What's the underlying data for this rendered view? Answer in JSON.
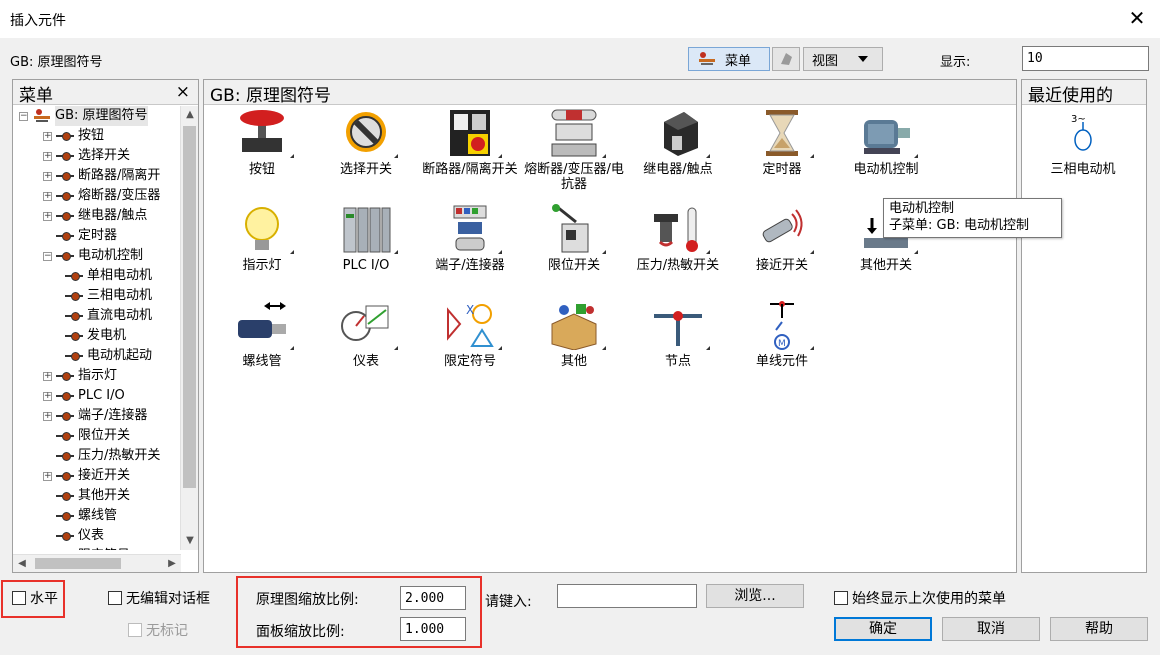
{
  "window": {
    "title": "插入元件",
    "close_glyph": "✕"
  },
  "toolbar": {
    "breadcrumb": "GB: 原理图符号",
    "menu_label": "菜单",
    "view_label": "视图",
    "display_label": "显示:",
    "display_value": "10"
  },
  "left_panel": {
    "title": "菜单",
    "close_glyph": "×",
    "root": "GB: 原理图符号",
    "items": [
      {
        "label": "按钮",
        "expandable": true,
        "indent": 1
      },
      {
        "label": "选择开关",
        "expandable": true,
        "indent": 1
      },
      {
        "label": "断路器/隔离开",
        "expandable": true,
        "indent": 1
      },
      {
        "label": "熔断器/变压器",
        "expandable": true,
        "indent": 1
      },
      {
        "label": "继电器/触点",
        "expandable": true,
        "indent": 1
      },
      {
        "label": "定时器",
        "expandable": false,
        "indent": 1
      },
      {
        "label": "电动机控制",
        "expandable": true,
        "expanded": true,
        "indent": 1
      },
      {
        "label": "单相电动机",
        "expandable": false,
        "indent": 2
      },
      {
        "label": "三相电动机",
        "expandable": false,
        "indent": 2
      },
      {
        "label": "直流电动机",
        "expandable": false,
        "indent": 2
      },
      {
        "label": "发电机",
        "expandable": false,
        "indent": 2
      },
      {
        "label": "电动机起动",
        "expandable": false,
        "indent": 2
      },
      {
        "label": "指示灯",
        "expandable": true,
        "indent": 1
      },
      {
        "label": "PLC I/O",
        "expandable": true,
        "indent": 1
      },
      {
        "label": "端子/连接器",
        "expandable": true,
        "indent": 1
      },
      {
        "label": "限位开关",
        "expandable": false,
        "indent": 1
      },
      {
        "label": "压力/热敏开关",
        "expandable": false,
        "indent": 1
      },
      {
        "label": "接近开关",
        "expandable": true,
        "indent": 1
      },
      {
        "label": "其他开关",
        "expandable": false,
        "indent": 1
      },
      {
        "label": "螺线管",
        "expandable": false,
        "indent": 1
      },
      {
        "label": "仪表",
        "expandable": false,
        "indent": 1
      },
      {
        "label": "限定符号",
        "expandable": true,
        "indent": 1
      }
    ]
  },
  "center_panel": {
    "title": "GB: 原理图符号",
    "items": [
      {
        "label": "按钮",
        "icon": "push-button-icon"
      },
      {
        "label": "选择开关",
        "icon": "selector-switch-icon"
      },
      {
        "label": "断路器/隔离开关",
        "icon": "circuit-breaker-icon"
      },
      {
        "label": "熔断器/变压器/电抗器",
        "icon": "fuse-transformer-icon"
      },
      {
        "label": "继电器/触点",
        "icon": "relay-icon"
      },
      {
        "label": "定时器",
        "icon": "hourglass-icon"
      },
      {
        "label": "电动机控制",
        "icon": "motor-icon"
      },
      {
        "label": "指示灯",
        "icon": "lightbulb-icon"
      },
      {
        "label": "PLC I/O",
        "icon": "plc-icon"
      },
      {
        "label": "端子/连接器",
        "icon": "terminal-icon"
      },
      {
        "label": "限位开关",
        "icon": "limit-switch-icon"
      },
      {
        "label": "压力/热敏开关",
        "icon": "pressure-switch-icon"
      },
      {
        "label": "接近开关",
        "icon": "proximity-switch-icon"
      },
      {
        "label": "其他开关",
        "icon": "other-switch-icon"
      },
      {
        "label": "螺线管",
        "icon": "solenoid-icon"
      },
      {
        "label": "仪表",
        "icon": "meter-icon"
      },
      {
        "label": "限定符号",
        "icon": "qualifier-icon"
      },
      {
        "label": "其他",
        "icon": "misc-box-icon"
      },
      {
        "label": "节点",
        "icon": "node-icon"
      },
      {
        "label": "单线元件",
        "icon": "one-line-icon"
      }
    ]
  },
  "tooltip": {
    "line1": "电动机控制",
    "line2": "子菜单: GB: 电动机控制"
  },
  "right_panel": {
    "title": "最近使用的",
    "items": [
      {
        "label": "三相电动机",
        "icon": "three-phase-motor-icon",
        "symbol_text": "3~"
      }
    ]
  },
  "bottom": {
    "horizontal_label": "水平",
    "no_edit_dialog_label": "无编辑对话框",
    "no_tag_label": "无标记",
    "schematic_scale_label": "原理图缩放比例:",
    "schematic_scale_value": "2.000",
    "panel_scale_label": "面板缩放比例:",
    "panel_scale_value": "1.000",
    "type_in_label": "请键入:",
    "browse_label": "浏览...",
    "always_show_label": "始终显示上次使用的菜单",
    "ok_label": "确定",
    "cancel_label": "取消",
    "help_label": "帮助"
  },
  "colors": {
    "highlight_box": "#e8312a",
    "primary_border": "#0078d7"
  }
}
